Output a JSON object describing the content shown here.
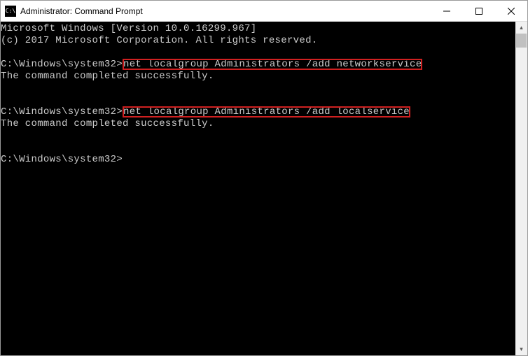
{
  "title": "Administrator: Command Prompt",
  "lines": {
    "l0": "Microsoft Windows [Version 10.0.16299.967]",
    "l1": "(c) 2017 Microsoft Corporation. All rights reserved.",
    "blank": "",
    "prompt1_prefix": "C:\\Windows\\system32>",
    "cmd1": "net localgroup Administrators /add networkservice",
    "resp1": "The command completed successfully.",
    "prompt2_prefix": "C:\\Windows\\system32>",
    "cmd2": "net localgroup Administrators /add localservice",
    "resp2": "The command completed successfully.",
    "prompt3": "C:\\Windows\\system32>"
  },
  "highlight_color": "#d02020"
}
